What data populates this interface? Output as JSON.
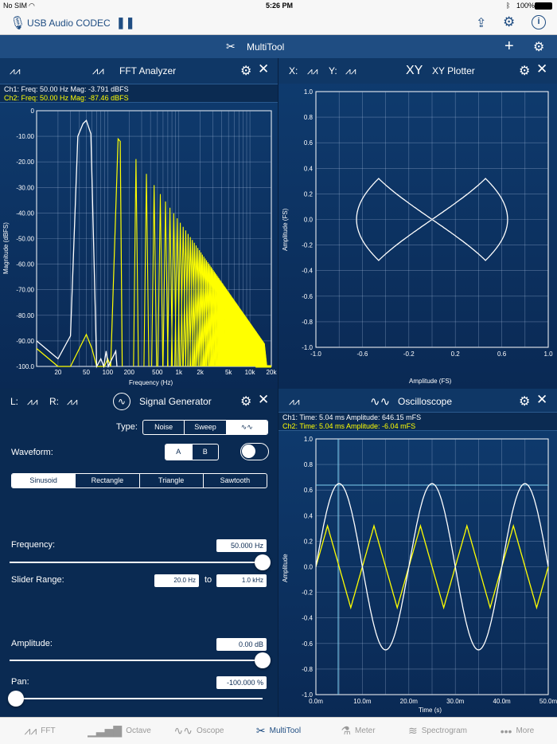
{
  "status": {
    "carrier": "No SIM",
    "time": "5:26 PM",
    "battery": "100%"
  },
  "toolbar": {
    "device": "USB Audio CODEC"
  },
  "nav": {
    "title": "MultiTool"
  },
  "fft": {
    "title": "FFT Analyzer",
    "ch1": "Ch1:  Freq: 50.00 Hz   Mag: -3.791 dBFS",
    "ch2": "Ch2:  Freq: 50.00 Hz   Mag: -87.46 dBFS",
    "ylabel": "Magnitude (dBFS)",
    "xlabel": "Frequency (Hz)",
    "yticks": [
      "0",
      "-10.00",
      "-20.00",
      "-30.00",
      "-40.00",
      "-50.00",
      "-60.00",
      "-70.00",
      "-80.00",
      "-90.00",
      "-100.0"
    ],
    "xticks": [
      "20",
      "50",
      "100",
      "200",
      "500",
      "1k",
      "2k",
      "5k",
      "10k",
      "20k"
    ]
  },
  "xy": {
    "x_label": "X:",
    "y_label": "Y:",
    "logo": "XY",
    "title": "XY Plotter",
    "ylabel": "Amplitude (FS)",
    "xlabel": "Amplitude (FS)",
    "yticks": [
      "1.0",
      "0.8",
      "0.6",
      "0.4",
      "0.2",
      "0.0",
      "-0.2",
      "-0.4",
      "-0.6",
      "-0.8",
      "-1.0"
    ],
    "xticks": [
      "-1.0",
      "-0.6",
      "-0.2",
      "0.2",
      "0.6",
      "1.0"
    ]
  },
  "gen": {
    "l_label": "L:",
    "r_label": "R:",
    "title": "Signal Generator",
    "type_label": "Type:",
    "type_options": [
      "Noise",
      "Sweep",
      "∿∿"
    ],
    "waveform_label": "Waveform:",
    "ab": [
      "A",
      "B"
    ],
    "shapes": [
      "Sinusoid",
      "Rectangle",
      "Triangle",
      "Sawtooth"
    ],
    "freq_label": "Frequency:",
    "freq_value": "50.000 Hz",
    "freq_fraction": 1.0,
    "range_label": "Slider Range:",
    "range_min": "20.0 Hz",
    "range_to": "to",
    "range_max": "1.0 kHz",
    "amp_label": "Amplitude:",
    "amp_value": "0.00 dB",
    "amp_fraction": 1.0,
    "pan_label": "Pan:",
    "pan_value": "-100.000 %",
    "pan_fraction": 0.0
  },
  "osc": {
    "title": "Oscilloscope",
    "ch1": "Ch1:  Time: 5.04 ms    Amplitude: 646.15 mFS",
    "ch2": "Ch2:  Time: 5.04 ms    Amplitude: -6.04 mFS",
    "ylabel": "Amplitude",
    "xlabel": "Time (s)",
    "yticks": [
      "1.0",
      "0.8",
      "0.6",
      "0.4",
      "0.2",
      "0.0",
      "-0.2",
      "-0.4",
      "-0.6",
      "-0.8",
      "-1.0"
    ],
    "xticks": [
      "0.0m",
      "10.0m",
      "20.0m",
      "30.0m",
      "40.0m",
      "50.0m"
    ]
  },
  "tabs": [
    "FFT",
    "Octave",
    "Oscope",
    "MultiTool",
    "Meter",
    "Spectrogram",
    "More"
  ],
  "colors": {
    "ch1": "#ffffff",
    "ch2": "#ffff00",
    "bg": "#0a2a52",
    "accent": "#1f4d82"
  }
}
